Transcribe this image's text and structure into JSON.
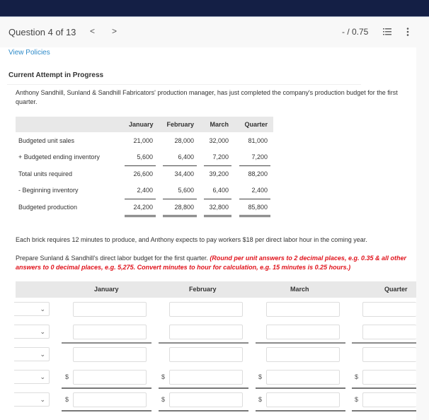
{
  "header": {
    "question_label": "Question 4 of 13",
    "prev_icon": "chevron-left-icon",
    "next_icon": "chevron-right-icon",
    "prev_glyph": "<",
    "next_glyph": ">",
    "score": "- / 0.75",
    "list_icon": "list-icon",
    "more_icon": "more-vertical-icon"
  },
  "links": {
    "view_policies": "View Policies"
  },
  "attempt_status": "Current Attempt in Progress",
  "intro_text": "Anthony Sandhill, Sunland & Sandhill Fabricators' production manager, has just completed the company's production budget for the first quarter.",
  "production_budget": {
    "columns": [
      "January",
      "February",
      "March",
      "Quarter"
    ],
    "rows": [
      {
        "label": "Budgeted unit sales",
        "values": [
          "21,000",
          "28,000",
          "32,000",
          "81,000"
        ]
      },
      {
        "label": "+ Budgeted ending inventory",
        "values": [
          "5,600",
          "6,400",
          "7,200",
          "7,200"
        ]
      },
      {
        "label": "Total units required",
        "values": [
          "26,600",
          "34,400",
          "39,200",
          "88,200"
        ]
      },
      {
        "label": "- Beginning inventory",
        "values": [
          "2,400",
          "5,600",
          "6,400",
          "2,400"
        ]
      },
      {
        "label": "Budgeted production",
        "values": [
          "24,200",
          "28,800",
          "32,800",
          "85,800"
        ]
      }
    ]
  },
  "info_text": "Each brick requires 12 minutes to produce, and Anthony expects to pay workers $18 per direct labor hour in the coming year.",
  "instruction_text": "Prepare Sunland & Sandhill's direct labor budget for the first quarter. ",
  "instruction_note": "(Round per unit answers to 2 decimal places, e.g. 0.35 & all other answers to 0 decimal places, e.g. 5,275. Convert minutes to hour for calculation, e.g. 15 minutes is 0.25 hours.)",
  "answer_table": {
    "columns": [
      "January",
      "February",
      "March",
      "Quarter"
    ],
    "dropdown_icon": "chevron-down-icon",
    "dropdown_glyph": "⌄",
    "currency_symbol": "$",
    "rows": [
      {
        "dropdown_value": "",
        "values": [
          "",
          "",
          "",
          ""
        ]
      },
      {
        "dropdown_value": "",
        "values": [
          "",
          "",
          "",
          ""
        ]
      },
      {
        "dropdown_value": "",
        "values": [
          "",
          "",
          "",
          ""
        ]
      },
      {
        "dropdown_value": "",
        "values": [
          "",
          "",
          "",
          ""
        ]
      },
      {
        "dropdown_value": "",
        "values": [
          "",
          "",
          "",
          ""
        ]
      }
    ]
  },
  "colors": {
    "topbar": "#141f45",
    "link": "#2f8bc9",
    "instruction_red": "#e0121b"
  }
}
